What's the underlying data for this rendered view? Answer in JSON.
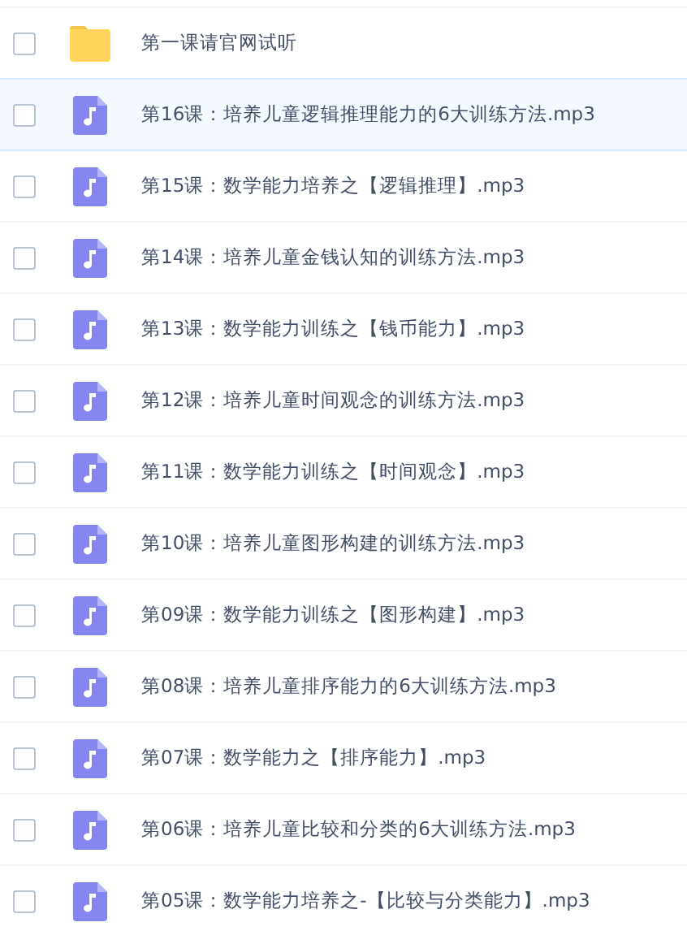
{
  "files": [
    {
      "kind": "folder",
      "name": "第一课请官网试听",
      "checked": false,
      "hovered": false
    },
    {
      "kind": "audio",
      "name": "第16课：培养儿童逻辑推理能力的6大训练方法.mp3",
      "checked": false,
      "hovered": true
    },
    {
      "kind": "audio",
      "name": "第15课：数学能力培养之【逻辑推理】.mp3",
      "checked": false,
      "hovered": false
    },
    {
      "kind": "audio",
      "name": "第14课：培养儿童金钱认知的训练方法.mp3",
      "checked": false,
      "hovered": false
    },
    {
      "kind": "audio",
      "name": "第13课：数学能力训练之【钱币能力】.mp3",
      "checked": false,
      "hovered": false
    },
    {
      "kind": "audio",
      "name": "第12课：培养儿童时间观念的训练方法.mp3",
      "checked": false,
      "hovered": false
    },
    {
      "kind": "audio",
      "name": "第11课：数学能力训练之【时间观念】.mp3",
      "checked": false,
      "hovered": false
    },
    {
      "kind": "audio",
      "name": "第10课：培养儿童图形构建的训练方法.mp3",
      "checked": false,
      "hovered": false
    },
    {
      "kind": "audio",
      "name": "第09课：数学能力训练之【图形构建】.mp3",
      "checked": false,
      "hovered": false
    },
    {
      "kind": "audio",
      "name": "第08课：培养儿童排序能力的6大训练方法.mp3",
      "checked": false,
      "hovered": false
    },
    {
      "kind": "audio",
      "name": "第07课：数学能力之【排序能力】.mp3",
      "checked": false,
      "hovered": false
    },
    {
      "kind": "audio",
      "name": "第06课：培养儿童比较和分类的6大训练方法.mp3",
      "checked": false,
      "hovered": false
    },
    {
      "kind": "audio",
      "name": "第05课：数学能力培养之-【比较与分类能力】.mp3",
      "checked": false,
      "hovered": false
    }
  ]
}
